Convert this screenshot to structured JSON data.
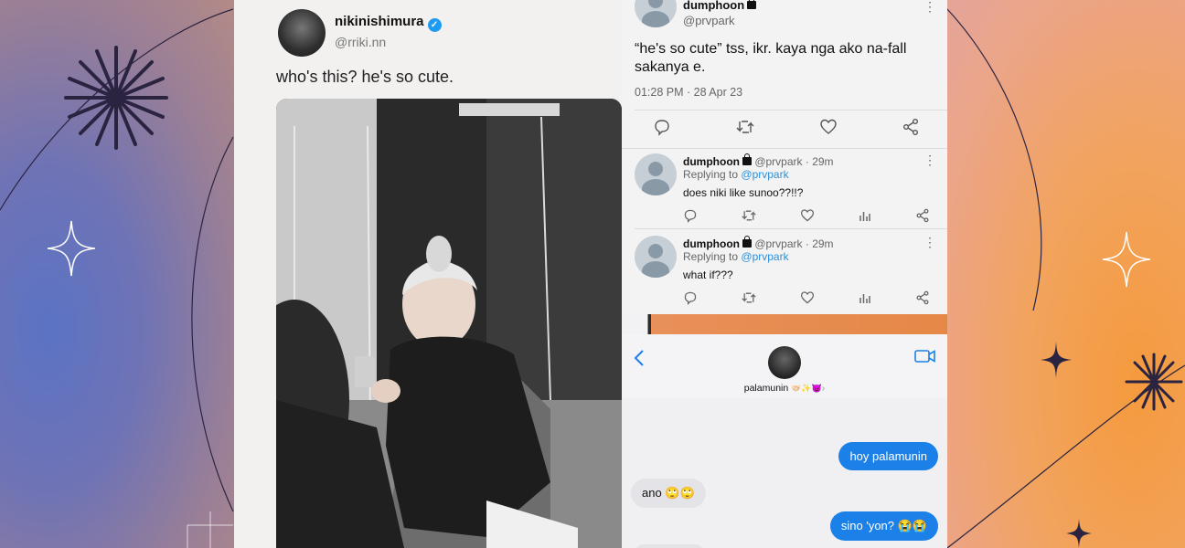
{
  "tweet_main": {
    "name": "nikinishimura",
    "verified_mark": "✓",
    "handle": "@rriki.nn",
    "text": "who's this? he's so cute."
  },
  "tweet_reply": {
    "name": "dumphoon",
    "handle": "@prvpark",
    "text": "“he's so cute” tss, ikr. kaya nga ako na-fall sakanya e.",
    "timestamp": "01:28 PM · 28 Apr 23"
  },
  "replies": [
    {
      "name": "dumphoon",
      "meta": "@prvpark · 29m",
      "replying_prefix": "Replying to",
      "replying_to": "@prvpark",
      "text": "does niki like sunoo??!!?"
    },
    {
      "name": "dumphoon",
      "meta": "@prvpark · 29m",
      "replying_prefix": "Replying to",
      "replying_to": "@prvpark",
      "text": "what if???"
    }
  ],
  "chat": {
    "contact_name": "palamunin",
    "contact_emoji": "🤝🏻✨😈",
    "contact_chevron": "›",
    "messages": [
      {
        "from": "me",
        "text": "hoy palamunin"
      },
      {
        "from": "them",
        "text": "ano 🙄🙄"
      },
      {
        "from": "me",
        "text": "sino 'yon? 😭😭"
      }
    ]
  },
  "colors": {
    "bubble_out": "#1b80e8",
    "bubble_in": "#e4e4e8",
    "link": "#2e8fd6",
    "verified": "#1d9bf0"
  }
}
